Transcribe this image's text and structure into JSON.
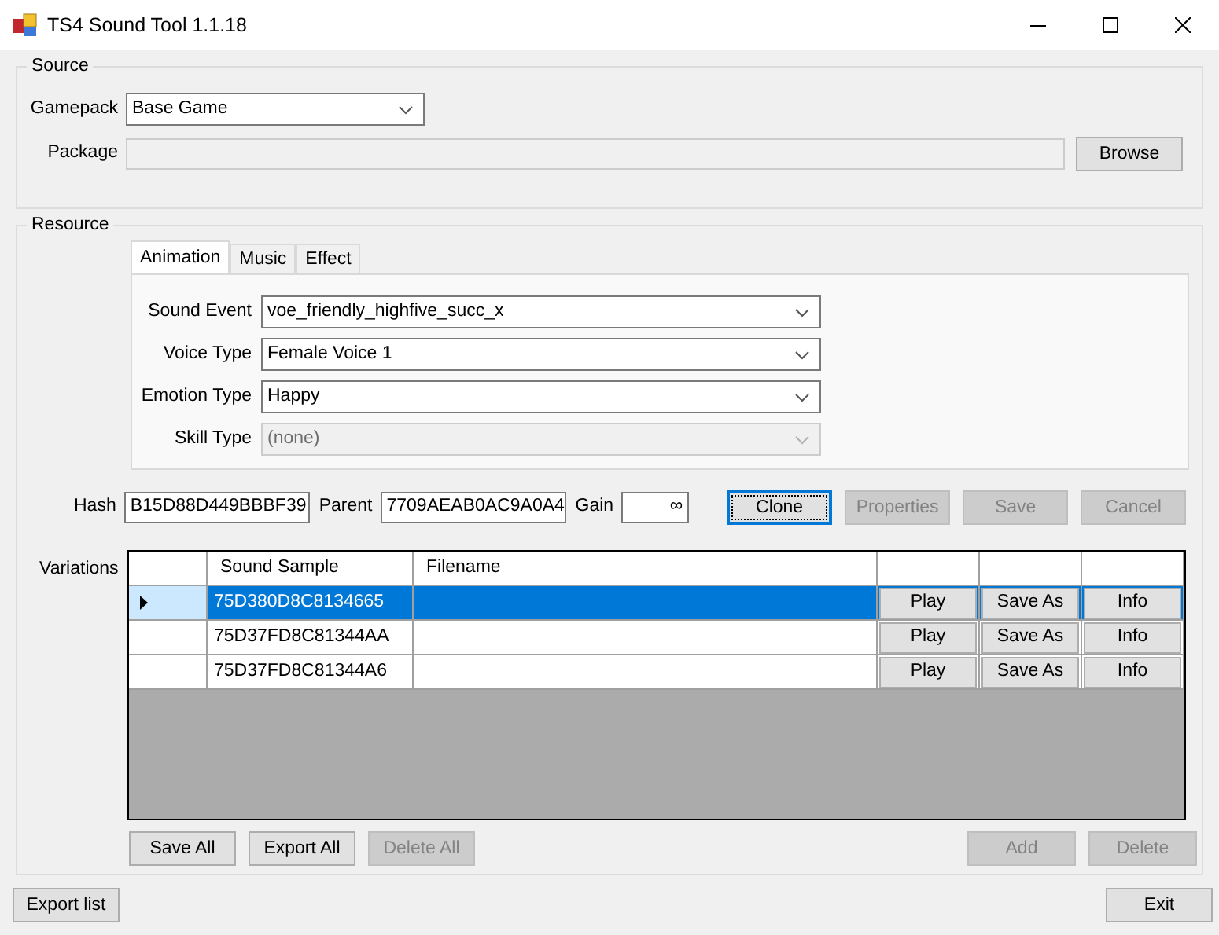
{
  "window": {
    "title": "TS4 Sound Tool 1.1.18"
  },
  "source": {
    "title": "Source",
    "fields": [
      {
        "label": "Gamepack",
        "kind": "dropdown",
        "value": "Base Game",
        "disabled": false
      },
      {
        "label": "Package",
        "kind": "text",
        "disabled": true
      }
    ],
    "browse_button": "Browse"
  },
  "resource": {
    "title": "Resource",
    "tabs": [
      {
        "label": "Animation",
        "selected": true
      },
      {
        "label": "Music",
        "selected": false
      },
      {
        "label": "Effect",
        "selected": false
      }
    ],
    "fields": [
      {
        "label": "Sound Event",
        "value": "voe_friendly_highfive_succ_x",
        "disabled": false
      },
      {
        "label": "Voice Type",
        "value": "Female Voice 1",
        "disabled": false
      },
      {
        "label": "Emotion Type",
        "value": "Happy",
        "disabled": false
      },
      {
        "label": "Skill Type",
        "value": "(none)",
        "disabled": true
      }
    ],
    "ids": [
      {
        "label": "Hash",
        "value": "B15D88D449BBBF39",
        "kind": "wide"
      },
      {
        "label": "Parent",
        "value": "7709AEAB0AC9A0A4",
        "kind": "wide"
      },
      {
        "label": "Gain",
        "value": "∞",
        "kind": "narrow"
      }
    ],
    "actions": [
      {
        "label": "Clone",
        "disabled": false,
        "focused": true
      },
      {
        "label": "Properties",
        "disabled": true,
        "focused": false
      },
      {
        "label": "Save",
        "disabled": true,
        "focused": false
      },
      {
        "label": "Cancel",
        "disabled": true,
        "focused": false
      }
    ],
    "variations": {
      "label": "Variations",
      "columns": [
        "Sound Sample",
        "Filename"
      ],
      "rows": [
        {
          "sample": "75D380D8C8134665",
          "selected": true,
          "buttons": [
            "Play",
            "Save As",
            "Info"
          ]
        },
        {
          "sample": "75D37FD8C81344AA",
          "selected": false,
          "buttons": [
            "Play",
            "Save As",
            "Info"
          ]
        },
        {
          "sample": "75D37FD8C81344A6",
          "selected": false,
          "buttons": [
            "Play",
            "Save As",
            "Info"
          ]
        }
      ]
    },
    "left_buttons": [
      {
        "label": "Save All",
        "disabled": false
      },
      {
        "label": "Export All",
        "disabled": false
      },
      {
        "label": "Delete All",
        "disabled": true
      }
    ],
    "right_buttons": [
      {
        "label": "Add",
        "disabled": true
      },
      {
        "label": "Delete",
        "disabled": true
      }
    ]
  },
  "footer_buttons": [
    "Export list",
    "Exit"
  ]
}
